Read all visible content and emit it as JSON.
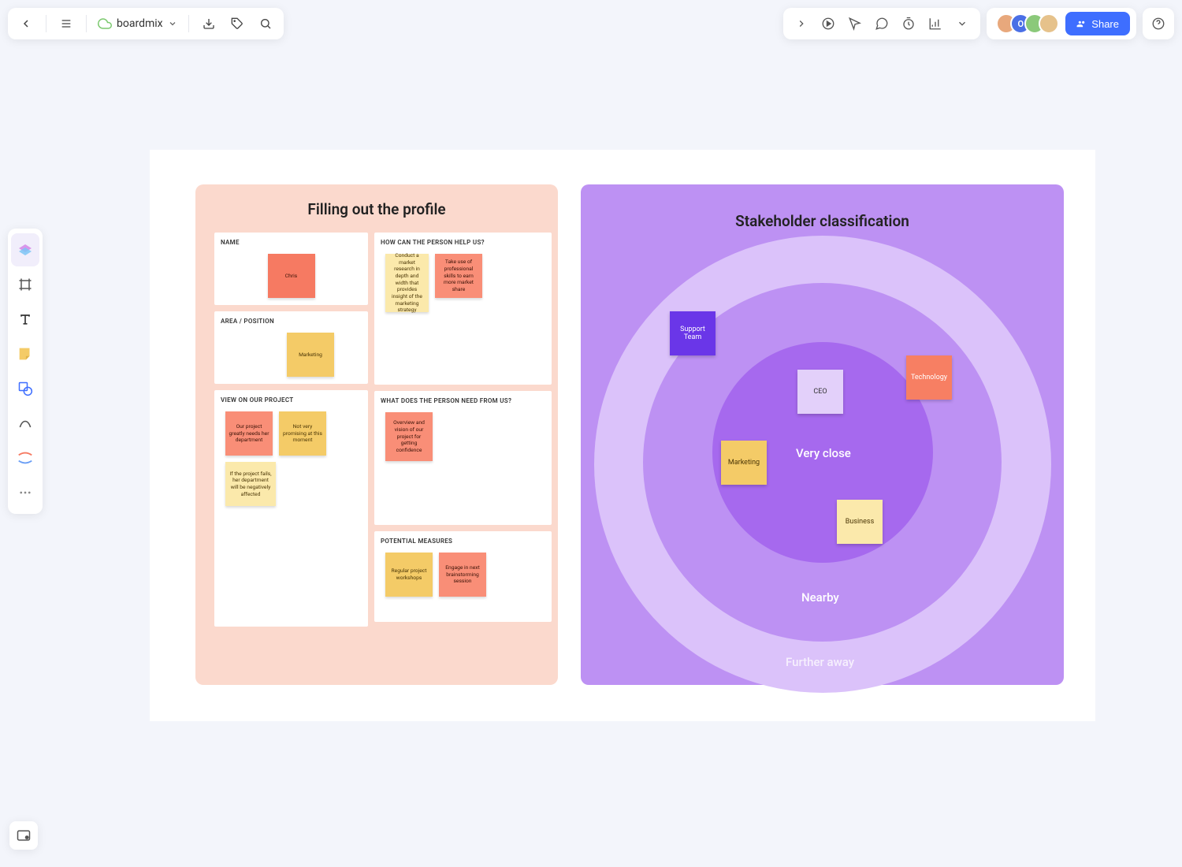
{
  "doc_name": "boardmix",
  "share_label": "Share",
  "profile": {
    "title": "Filling out the profile",
    "cards": {
      "name": {
        "label": "NAME",
        "notes": [
          "Chris"
        ]
      },
      "area": {
        "label": "AREA / POSITION",
        "notes": [
          "Marketing"
        ]
      },
      "help": {
        "label": "HOW CAN THE PERSON HELP US?",
        "notes": [
          "Conduct a market research in depth and width that provides insight of the marketing strategy",
          "Take use of professional skills to earn more market share"
        ]
      },
      "view": {
        "label": "VIEW ON OUR PROJECT",
        "notes": [
          "Our project greatly needs her department",
          "Not very promising at this moment",
          "If the project fails, her department will be negatively affected"
        ]
      },
      "need": {
        "label": "WHAT DOES THE PERSON NEED FROM US?",
        "notes": [
          "Overview and vision of our project for getting confidence"
        ]
      },
      "measures": {
        "label": "POTENTIAL MEASURES",
        "notes": [
          "Regular project workshops",
          "Engage in next brainstorming session"
        ]
      }
    }
  },
  "stakeholder": {
    "title": "Stakeholder classification",
    "rings": {
      "inner": "Very close",
      "mid": "Nearby",
      "outer": "Further away"
    },
    "notes": {
      "support": "Support Team",
      "ceo": "CEO",
      "technology": "Technology",
      "marketing": "Marketing",
      "business": "Business"
    }
  }
}
